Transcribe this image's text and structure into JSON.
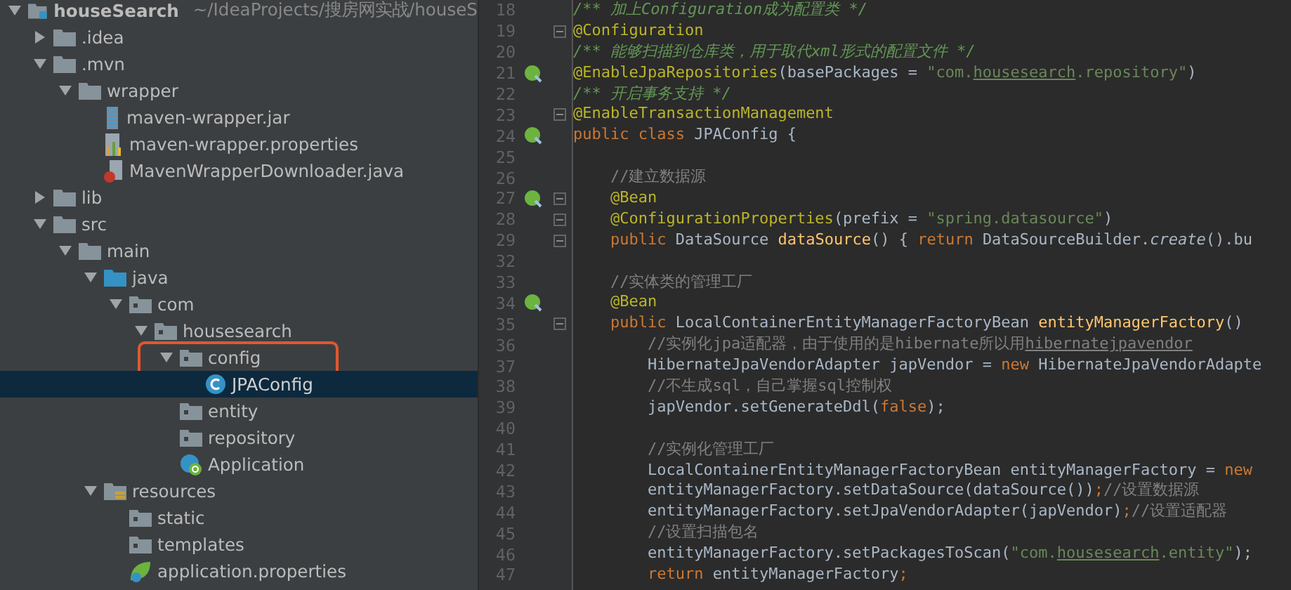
{
  "project_tree": {
    "items": [
      {
        "label": "houseSearch",
        "path": "~/IdeaProjects/搜房网实战/houseS",
        "kind": "project",
        "expanded": true,
        "selected": false,
        "children": [
          {
            "label": ".idea",
            "kind": "folder",
            "expanded": false,
            "selected": false
          },
          {
            "label": ".mvn",
            "kind": "folder",
            "expanded": true,
            "selected": false,
            "children": [
              {
                "label": "wrapper",
                "kind": "folder",
                "expanded": true,
                "selected": false,
                "children": [
                  {
                    "label": "maven-wrapper.jar",
                    "kind": "jar",
                    "selected": false
                  },
                  {
                    "label": "maven-wrapper.properties",
                    "kind": "properties",
                    "selected": false
                  },
                  {
                    "label": "MavenWrapperDownloader.java",
                    "kind": "java",
                    "selected": false
                  }
                ]
              }
            ]
          },
          {
            "label": "lib",
            "kind": "folder",
            "expanded": false,
            "selected": false
          },
          {
            "label": "src",
            "kind": "folder",
            "expanded": true,
            "selected": false,
            "children": [
              {
                "label": "main",
                "kind": "folder",
                "expanded": true,
                "selected": false,
                "children": [
                  {
                    "label": "java",
                    "kind": "source",
                    "expanded": true,
                    "selected": false,
                    "children": [
                      {
                        "label": "com",
                        "kind": "package",
                        "expanded": true,
                        "selected": false,
                        "children": [
                          {
                            "label": "housesearch",
                            "kind": "package",
                            "expanded": true,
                            "selected": false,
                            "children": [
                              {
                                "label": "config",
                                "kind": "package",
                                "expanded": true,
                                "selected": false,
                                "outlined": true,
                                "children": [
                                  {
                                    "label": "JPAConfig",
                                    "kind": "class",
                                    "selected": true
                                  }
                                ]
                              },
                              {
                                "label": "entity",
                                "kind": "package",
                                "selected": false
                              },
                              {
                                "label": "repository",
                                "kind": "package",
                                "selected": false
                              },
                              {
                                "label": "Application",
                                "kind": "spring-class",
                                "selected": false
                              }
                            ]
                          }
                        ]
                      }
                    ]
                  },
                  {
                    "label": "resources",
                    "kind": "resources",
                    "expanded": true,
                    "selected": false,
                    "children": [
                      {
                        "label": "static",
                        "kind": "package",
                        "selected": false
                      },
                      {
                        "label": "templates",
                        "kind": "package",
                        "selected": false
                      },
                      {
                        "label": "application.properties",
                        "kind": "spring-properties",
                        "selected": false
                      }
                    ]
                  }
                ]
              }
            ]
          }
        ]
      }
    ]
  },
  "editor": {
    "lines": [
      {
        "number": "18",
        "segments": [
          {
            "text": "/** 加上Configuration成为配置类 */",
            "kind": "doc"
          }
        ]
      },
      {
        "number": "19",
        "fold": true,
        "segments": [
          {
            "text": "@Configuration",
            "kind": "annotation"
          }
        ]
      },
      {
        "number": "20",
        "segments": [
          {
            "text": "/** 能够扫描到仓库类，用于取代xml形式的配置文件 */",
            "kind": "doc"
          }
        ]
      },
      {
        "number": "21",
        "gutter_icon": true,
        "segments": [
          {
            "text": "@EnableJpaRepositories",
            "kind": "annotation"
          },
          {
            "text": "(basePackages = ",
            "kind": "plain"
          },
          {
            "text": "\"com.",
            "kind": "string"
          },
          {
            "text": "housesearch",
            "kind": "string-underlined"
          },
          {
            "text": ".repository\"",
            "kind": "string"
          },
          {
            "text": ")",
            "kind": "plain"
          }
        ]
      },
      {
        "number": "22",
        "segments": [
          {
            "text": "/** 开启事务支持 */",
            "kind": "doc"
          }
        ]
      },
      {
        "number": "23",
        "fold": true,
        "segments": [
          {
            "text": "@EnableTransactionManagement",
            "kind": "annotation"
          }
        ]
      },
      {
        "number": "24",
        "gutter_icon": true,
        "segments": [
          {
            "text": "public class ",
            "kind": "keyword"
          },
          {
            "text": "JPAConfig {",
            "kind": "plain"
          }
        ]
      },
      {
        "number": "25"
      },
      {
        "number": "26",
        "segments": [
          {
            "text": "    //建立数据源",
            "kind": "comment"
          }
        ]
      },
      {
        "number": "27",
        "gutter_icon": true,
        "fold": true,
        "segments": [
          {
            "text": "    @Bean",
            "kind": "annotation"
          }
        ]
      },
      {
        "number": "28",
        "fold": true,
        "segments": [
          {
            "text": "    @ConfigurationProperties",
            "kind": "annotation"
          },
          {
            "text": "(prefix = ",
            "kind": "plain"
          },
          {
            "text": "\"spring.datasource\"",
            "kind": "string"
          },
          {
            "text": ")",
            "kind": "plain"
          }
        ]
      },
      {
        "number": "29",
        "fold": true,
        "segments": [
          {
            "text": "    public ",
            "kind": "keyword"
          },
          {
            "text": "DataSource ",
            "kind": "plain"
          },
          {
            "text": "dataSource",
            "kind": "method"
          },
          {
            "text": "() { ",
            "kind": "plain"
          },
          {
            "text": "return ",
            "kind": "keyword"
          },
          {
            "text": "DataSourceBuilder.",
            "kind": "plain"
          },
          {
            "text": "create",
            "kind": "static"
          },
          {
            "text": "().bu",
            "kind": "plain"
          }
        ]
      },
      {
        "number": "32"
      },
      {
        "number": "33",
        "segments": [
          {
            "text": "    //实体类的管理工厂",
            "kind": "comment"
          }
        ]
      },
      {
        "number": "34",
        "gutter_icon": true,
        "segments": [
          {
            "text": "    @Bean",
            "kind": "annotation"
          }
        ]
      },
      {
        "number": "35",
        "fold": true,
        "segments": [
          {
            "text": "    public ",
            "kind": "keyword"
          },
          {
            "text": "LocalContainerEntityManagerFactoryBean ",
            "kind": "plain"
          },
          {
            "text": "entityManagerFactory",
            "kind": "method"
          },
          {
            "text": "()",
            "kind": "plain"
          }
        ]
      },
      {
        "number": "36",
        "segments": [
          {
            "text": "        //实例化jpa适配器，由于使用的是hibernate所以用",
            "kind": "comment"
          },
          {
            "text": "hibernatejpavendor",
            "kind": "comment-underlined"
          }
        ]
      },
      {
        "number": "37",
        "segments": [
          {
            "text": "        HibernateJpaVendorAdapter japVendor = ",
            "kind": "plain"
          },
          {
            "text": "new ",
            "kind": "keyword"
          },
          {
            "text": "HibernateJpaVendorAdapte",
            "kind": "plain"
          }
        ]
      },
      {
        "number": "38",
        "segments": [
          {
            "text": "        //不生成sql，自己掌握sql控制权",
            "kind": "comment"
          }
        ]
      },
      {
        "number": "39",
        "segments": [
          {
            "text": "        japVendor.setGenerateDdl(",
            "kind": "plain"
          },
          {
            "text": "false",
            "kind": "keyword"
          },
          {
            "text": ");",
            "kind": "plain"
          }
        ]
      },
      {
        "number": "40"
      },
      {
        "number": "41",
        "segments": [
          {
            "text": "        //实例化管理工厂",
            "kind": "comment"
          }
        ]
      },
      {
        "number": "42",
        "segments": [
          {
            "text": "        LocalContainerEntityManagerFactoryBean entityManagerFactory = ",
            "kind": "plain"
          },
          {
            "text": "new",
            "kind": "keyword"
          }
        ]
      },
      {
        "number": "43",
        "segments": [
          {
            "text": "        entityManagerFactory.setDataSource(dataSource())",
            "kind": "plain"
          },
          {
            "text": ";",
            "kind": "keyword"
          },
          {
            "text": "//设置数据源",
            "kind": "comment"
          }
        ]
      },
      {
        "number": "44",
        "segments": [
          {
            "text": "        entityManagerFactory.setJpaVendorAdapter(japVendor)",
            "kind": "plain"
          },
          {
            "text": ";",
            "kind": "keyword"
          },
          {
            "text": "//设置适配器",
            "kind": "comment"
          }
        ]
      },
      {
        "number": "45",
        "segments": [
          {
            "text": "        //设置扫描包名",
            "kind": "comment"
          }
        ]
      },
      {
        "number": "46",
        "segments": [
          {
            "text": "        entityManagerFactory.setPackagesToScan(",
            "kind": "plain"
          },
          {
            "text": "\"com.",
            "kind": "string"
          },
          {
            "text": "housesearch",
            "kind": "string-underlined"
          },
          {
            "text": ".entity\"",
            "kind": "string"
          },
          {
            "text": ");",
            "kind": "plain"
          }
        ]
      },
      {
        "number": "47",
        "segments": [
          {
            "text": "        return ",
            "kind": "keyword"
          },
          {
            "text": "entityManagerFactory",
            "kind": "plain"
          },
          {
            "text": ";",
            "kind": "keyword"
          }
        ]
      }
    ]
  }
}
